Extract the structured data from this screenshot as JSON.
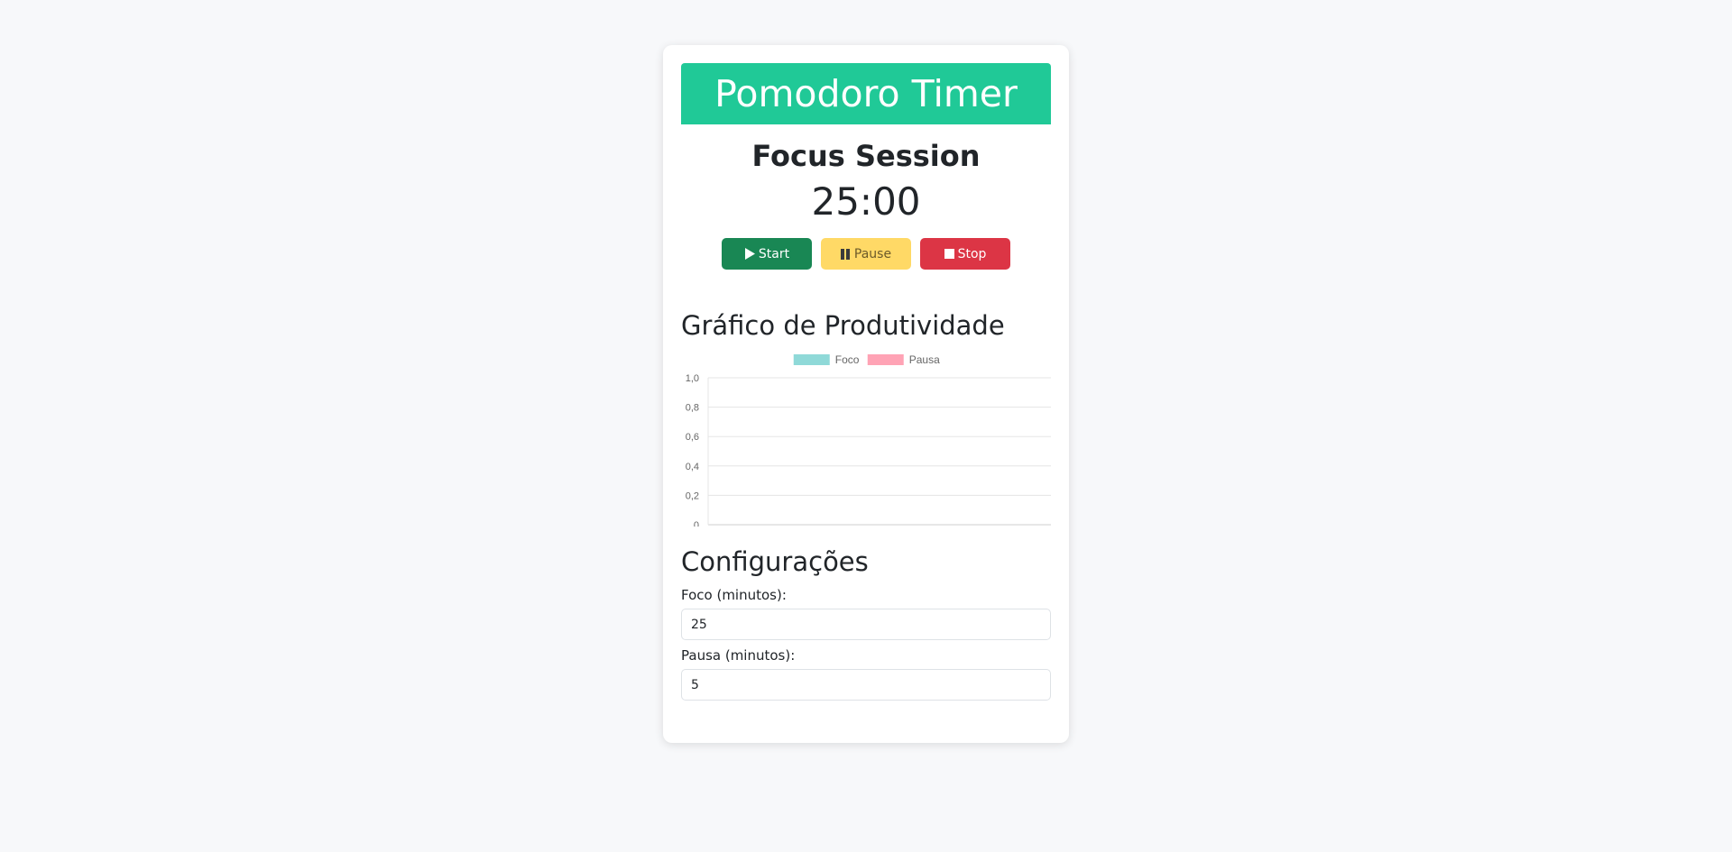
{
  "app": {
    "header_title": "Pomodoro Timer",
    "session_title": "Focus Session",
    "timer_display": "25:00"
  },
  "controls": {
    "start_label": "Start",
    "pause_label": "Pause",
    "stop_label": "Stop"
  },
  "chart_section": {
    "title": "Gráfico de Produtividade"
  },
  "chart_data": {
    "type": "bar",
    "categories": [],
    "series": [
      {
        "name": "Foco",
        "values": [],
        "color": "#8fd9d8"
      },
      {
        "name": "Pausa",
        "values": [],
        "color": "#ffa3b5"
      }
    ],
    "y_ticks": [
      "0",
      "0,2",
      "0,4",
      "0,6",
      "0,8",
      "1,0"
    ],
    "ylim": [
      0,
      1
    ],
    "grid": true,
    "legend_position": "top-center"
  },
  "settings": {
    "title": "Configurações",
    "focus_label": "Foco (minutos):",
    "focus_value": "25",
    "pause_label": "Pausa (minutos):",
    "pause_value": "5"
  },
  "colors": {
    "header_bg": "#20c997",
    "start_bg": "#198754",
    "pause_bg": "#ffd966",
    "stop_bg": "#dc3545"
  },
  "icons": {
    "start": "play-icon",
    "pause": "pause-icon",
    "stop": "stop-icon"
  }
}
